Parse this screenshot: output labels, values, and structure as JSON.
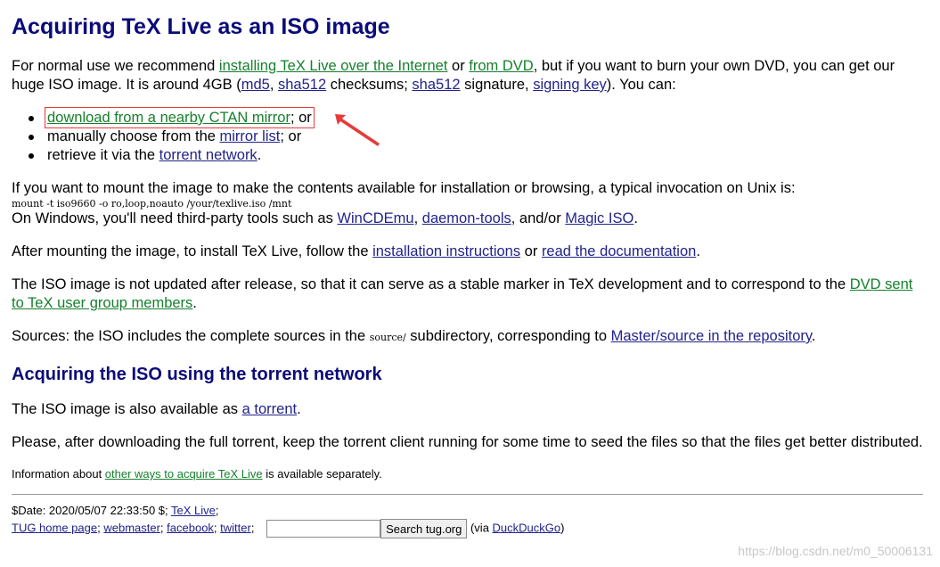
{
  "title": "Acquiring TeX Live as an ISO image",
  "intro": {
    "t1": "For normal use we recommend ",
    "link_internet": "installing TeX Live over the Internet",
    "t2": " or ",
    "link_dvd": "from DVD",
    "t3": ", but if you want to burn your own DVD, you can get our huge ISO image. It is around 4GB (",
    "link_md5": "md5",
    "t4": ", ",
    "link_sha512": "sha512",
    "t5": " checksums; ",
    "link_sha512sig": "sha512",
    "t6": " signature, ",
    "link_signing_key": "signing key",
    "t7": "). You can:"
  },
  "options": {
    "o1_link": "download from a nearby CTAN mirror",
    "o1_tail": "; or",
    "o2_text": "manually choose from the ",
    "o2_link": "mirror list",
    "o2_tail": "; or",
    "o3_text": "retrieve it via the ",
    "o3_link": "torrent network",
    "o3_tail": "."
  },
  "mount": {
    "text": "If you want to mount the image to make the contents available for installation or browsing, a typical invocation on Unix is:",
    "command": "mount -t iso9660 -o ro,loop,noauto /your/texlive.iso /mnt",
    "win_text": "On Windows, you'll need third-party tools such as ",
    "link_wincdemu": "WinCDEmu",
    "sep1": ", ",
    "link_daemon": "daemon-tools",
    "sep2": ", and/or ",
    "link_magiciso": "Magic ISO",
    "end": "."
  },
  "after": {
    "t1": "After mounting the image, to install TeX Live, follow the ",
    "link_install": "installation instructions",
    "t2": " or ",
    "link_docs": "read the documentation",
    "t3": "."
  },
  "iso_update": {
    "text": "The ISO image is not updated after release, so that it can serve as a stable marker in TeX development and to correspond to the ",
    "link": "DVD sent to TeX user group members",
    "end": "."
  },
  "sources": {
    "t1": "Sources: the ISO includes the complete sources in the ",
    "code": "source/",
    "t2": " subdirectory, corresponding to ",
    "link": "Master/source in the repository",
    "t3": "."
  },
  "torrent_heading": "Acquiring the ISO using the torrent network",
  "torrent": {
    "t1": "The ISO image is also available as ",
    "link": "a torrent",
    "t2": ".",
    "seed_text": "Please, after downloading the full torrent, keep the torrent client running for some time to seed the files so that the files get better distributed."
  },
  "info": {
    "t1": "Information about ",
    "link": "other ways to acquire TeX Live",
    "t2": " is available separately."
  },
  "footer": {
    "date": "$Date: 2020/05/07 22:33:50 $; ",
    "link_texlive": "TeX Live",
    "semi": ";",
    "link_tug": "TUG home page",
    "s1": "; ",
    "link_webmaster": "webmaster",
    "s2": "; ",
    "link_facebook": "facebook",
    "s3": "; ",
    "link_twitter": "twitter",
    "s4": ";",
    "search_value": "",
    "search_button": "Search tug.org",
    "via_open": " (via ",
    "link_ddg": "DuckDuckGo",
    "via_close": ")"
  },
  "watermark": "https://blog.csdn.net/m0_50006131",
  "colors": {
    "heading": "#0b0b7a",
    "link_green": "#16802d",
    "link_blue": "#21238a",
    "highlight": "#e83a3a"
  }
}
